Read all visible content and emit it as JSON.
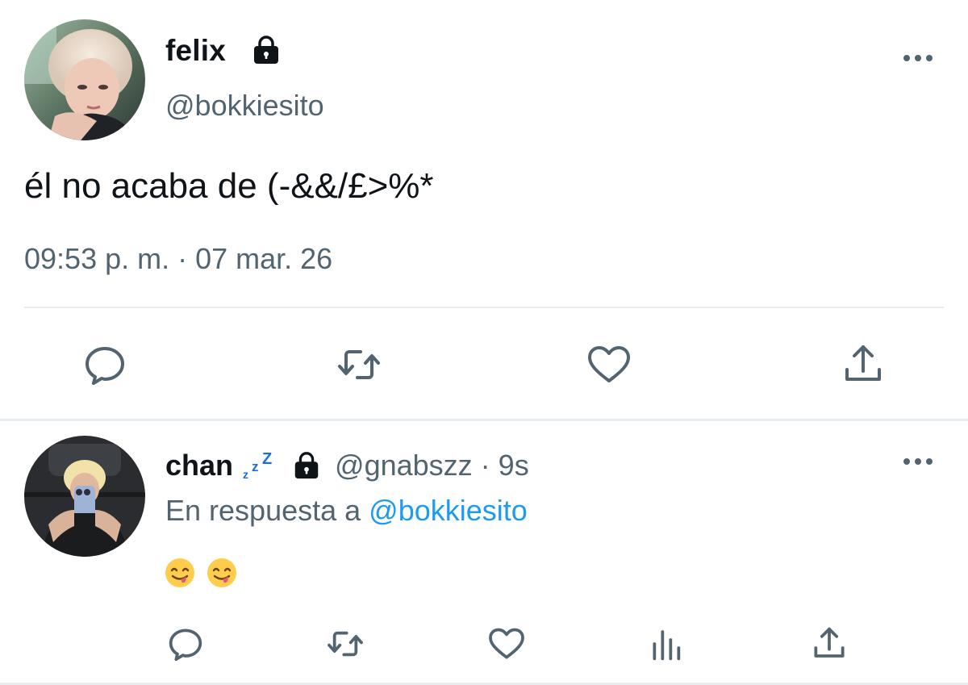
{
  "main_tweet": {
    "display_name": "felix",
    "handle": "@bokkiesito",
    "text": "él no acaba de (-&&/£>%*",
    "timestamp": "09:53 p. m. · 07 mar. 26",
    "protected_icon": "lock-icon",
    "actions": [
      "reply-icon",
      "retweet-icon",
      "like-icon",
      "share-icon"
    ]
  },
  "reply": {
    "display_name": "chan",
    "name_emoji": "zzz-emoji",
    "handle": "@gnabszz",
    "separator": "·",
    "time": "9s",
    "reply_prefix": "En respuesta a",
    "reply_mention": "@bokkiesito",
    "emojis": [
      "yum-emoji",
      "yum-emoji"
    ],
    "actions": [
      "reply-icon",
      "retweet-icon",
      "like-icon",
      "analytics-icon",
      "share-icon"
    ]
  },
  "colors": {
    "text": "#0f1419",
    "secondary": "#536471",
    "link": "#1d9bf0",
    "divider": "#e6ecf0",
    "zzz": "#1d6fd6"
  }
}
